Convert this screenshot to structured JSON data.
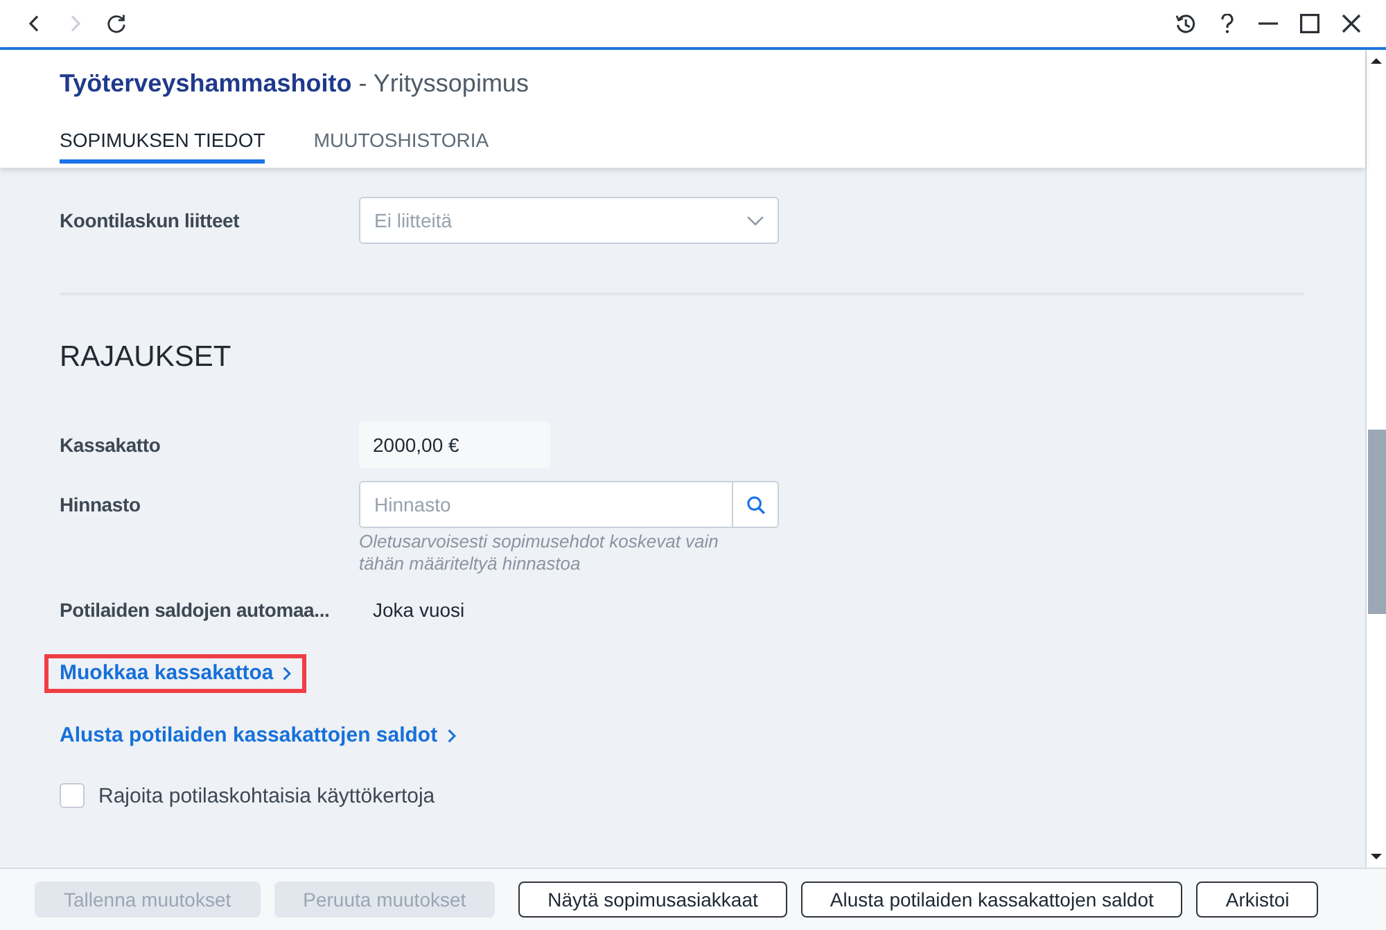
{
  "toolbar": {
    "nav_buttons": [
      {
        "kind": "back",
        "disabled": false
      },
      {
        "kind": "forward",
        "disabled": true
      },
      {
        "kind": "refresh",
        "disabled": false
      }
    ],
    "window_buttons": [
      {
        "kind": "history"
      },
      {
        "kind": "help"
      },
      {
        "kind": "minimize"
      },
      {
        "kind": "maximize"
      },
      {
        "kind": "close"
      }
    ]
  },
  "header": {
    "title": "Työterveyshammashoito",
    "subtitle": "- Yrityssopimus"
  },
  "tabs": [
    {
      "label": "SOPIMUKSEN TIEDOT",
      "selected": true
    },
    {
      "label": "MUUTOSHISTORIA",
      "selected": false
    }
  ],
  "invoice_section": {
    "fields": [
      {
        "kind": "dropdown",
        "label": "Koontilaskun liitteet",
        "placeholder": "Ei liitteitä"
      }
    ]
  },
  "limits_section": {
    "heading": "RAJAUKSET",
    "fields": [
      {
        "kind": "readonly",
        "label": "Kassakatto",
        "value": "2000,00 €"
      },
      {
        "kind": "search",
        "label": "Hinnasto",
        "placeholder": "Hinnasto",
        "hint": "Oletusarvoisesti sopimusehdot koskevat vain tähän määriteltyä hinnastoa"
      },
      {
        "kind": "text",
        "label": "Potilaiden saldojen automaa...",
        "value": "Joka vuosi"
      }
    ],
    "links": [
      {
        "label": "Muokkaa kassakattoa",
        "highlighted": true
      },
      {
        "label": "Alusta potilaiden kassakattojen saldot",
        "highlighted": false
      }
    ],
    "checkboxes": [
      {
        "label": "Rajoita potilaskohtaisia käyttökertoja",
        "checked": false
      }
    ]
  },
  "footer": {
    "buttons": [
      {
        "label": "Tallenna muutokset",
        "disabled": true
      },
      {
        "label": "Peruuta muutokset",
        "disabled": true
      },
      {
        "label": "Näytä sopimusasiakkaat",
        "disabled": false
      },
      {
        "label": "Alusta potilaiden kassakattojen saldot",
        "disabled": false
      },
      {
        "label": "Arkistoi",
        "disabled": false
      }
    ]
  }
}
